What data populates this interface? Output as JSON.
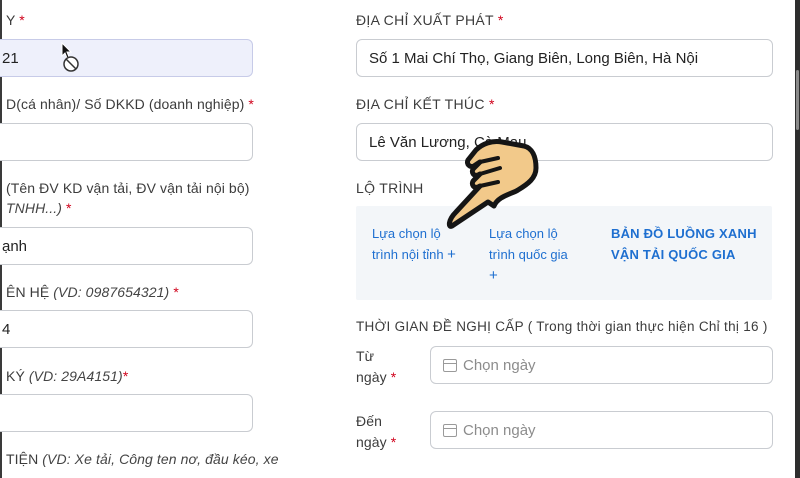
{
  "left_column": {
    "label1": "Y",
    "field1_value": "21",
    "label2": "D(cá nhân)/ Số DKKD (doanh nghiệp)",
    "field2_value": "",
    "label3_line1": "(Tên ĐV KD vận tải, ĐV vận tải nội bộ)",
    "label3_line2": "TNHH...)",
    "field3_value": "ạnh",
    "label4_main": "ÊN HỆ",
    "label4_hint": "(VD: 0987654321)",
    "field4_value": "4",
    "label5_main": "KÝ",
    "label5_hint": "(VD: 29A4151)",
    "field5_value": "",
    "label6_main": "TIỆN",
    "label6_hint": "(VD: Xe tải, Công ten nơ, đầu kéo, xe"
  },
  "right_column": {
    "start_label": "ĐỊA CHỈ XUẤT PHÁT",
    "start_value": "Số 1 Mai Chí Thọ, Giang Biên, Long Biên, Hà Nội",
    "end_label": "ĐỊA CHỈ KẾT THÚC",
    "end_value": "Lê Văn Lương, Cà Mau",
    "route_label": "LỘ TRÌNH",
    "route_options": {
      "provincial_line1": "Lựa chọn lộ",
      "provincial_line2": "trình nội tỉnh",
      "national_line1": "Lựa chọn lộ",
      "national_line2": "trình quốc gia",
      "plus": "+",
      "map_line1": "BẢN ĐỒ LUỒNG XANH",
      "map_line2": "VẬN TẢI QUỐC GIA"
    },
    "time_label": "THỜI GIAN ĐỀ NGHỊ CẤP ( Trong thời gian thực hiện Chỉ thị 16 )",
    "from_label_line1": "Từ",
    "from_label_line2": "ngày",
    "to_label_line1": "Đến",
    "to_label_line2": "ngày",
    "date_placeholder": "Chọn ngày"
  },
  "required_mark": "*",
  "colors": {
    "required": "#d0021b",
    "link": "#1e6fd0",
    "route_bg": "#f3f6f9",
    "active_field_bg": "#eef0fb"
  },
  "icons": [
    "calendar-icon",
    "plus-icon",
    "mouse-cursor-icon",
    "busy-cursor-icon",
    "pointing-hand-icon"
  ]
}
